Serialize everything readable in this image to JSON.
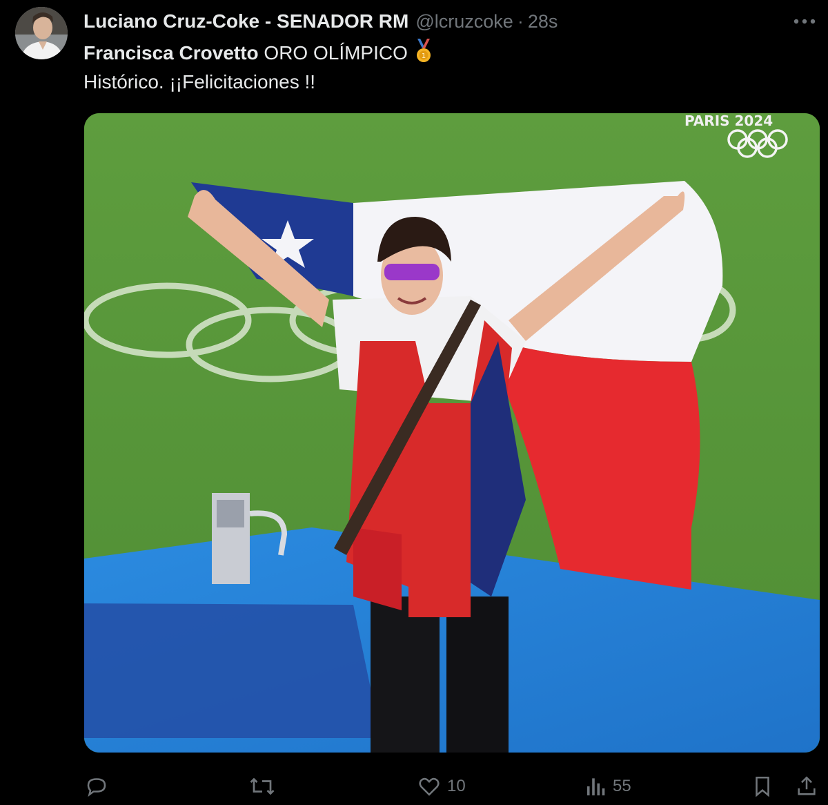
{
  "tweet": {
    "author": {
      "display_name": "Luciano Cruz-Coke - SENADOR RM",
      "handle": "@lcruzcoke",
      "separator": "·",
      "timestamp": "28s",
      "avatar_icon": "person-avatar-icon"
    },
    "more_label": "···",
    "text": {
      "mention": "Francisca Crovetto",
      "line1_rest": " ORO OLÍMPICO ",
      "medal_icon": "gold-medal-icon",
      "line2": "Histórico. ¡¡Felicitaciones !!"
    },
    "media": {
      "overlay_text": "PARIS 2024",
      "content": "photo-athlete-with-chile-flag"
    },
    "actions": {
      "reply": {
        "icon": "reply-icon",
        "count": ""
      },
      "retweet": {
        "icon": "retweet-icon",
        "count": ""
      },
      "like": {
        "icon": "heart-icon",
        "count": "10"
      },
      "views": {
        "icon": "views-chart-icon",
        "count": "55"
      },
      "bookmark": {
        "icon": "bookmark-icon"
      },
      "share": {
        "icon": "share-icon"
      }
    }
  },
  "colors": {
    "background": "#000000",
    "primary_text": "#e7e9ea",
    "secondary_text": "#71767b",
    "field_green": "#5a9a3c",
    "flag_blue": "#1f3a93",
    "flag_red": "#e62a2f",
    "flag_white": "#f4f4f8",
    "mat_blue": "#1f7fd6"
  }
}
